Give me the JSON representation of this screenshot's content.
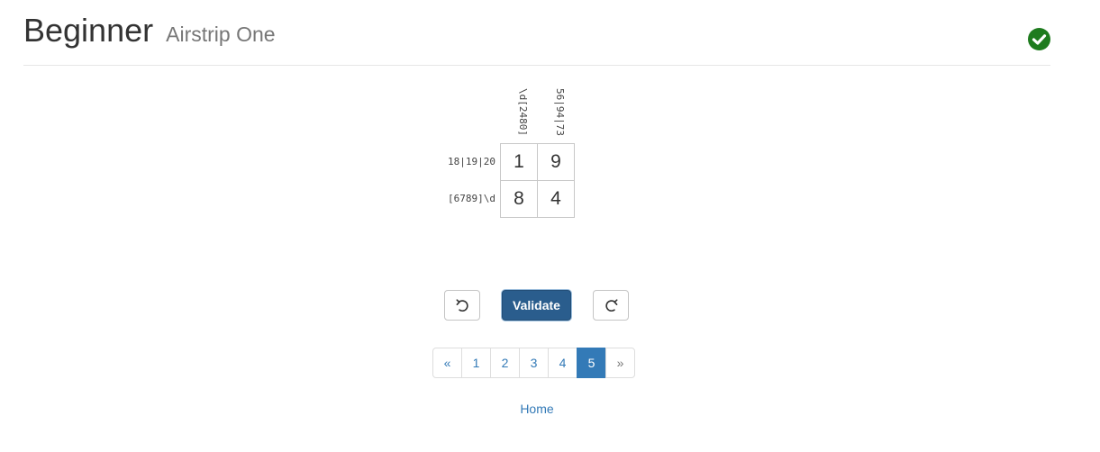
{
  "header": {
    "title": "Beginner",
    "subtitle": "Airstrip One",
    "status_icon": "check-circle-icon",
    "status_color": "#1e7b1e"
  },
  "puzzle": {
    "column_clues": [
      "\\d[2480]",
      "56|94|73"
    ],
    "row_clues": [
      "18|19|20",
      "[6789]\\d"
    ],
    "cells": [
      [
        "1",
        "9"
      ],
      [
        "8",
        "4"
      ]
    ]
  },
  "controls": {
    "undo_icon": "undo-icon",
    "redo_icon": "redo-icon",
    "validate_label": "Validate",
    "validate_color": "#2a5d8d"
  },
  "pagination": {
    "prev": "«",
    "pages": [
      "1",
      "2",
      "3",
      "4",
      "5"
    ],
    "active_page": "5",
    "next": "»",
    "accent_color": "#337ab7"
  },
  "footer": {
    "home_label": "Home"
  }
}
